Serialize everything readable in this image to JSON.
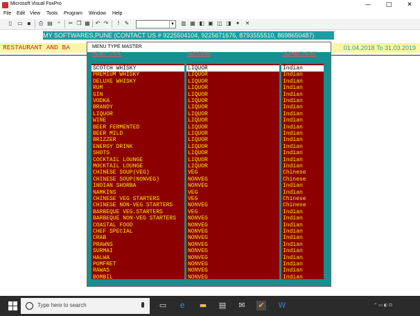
{
  "window": {
    "title": "Microsoft Visual FoxPro"
  },
  "menu": [
    "File",
    "Edit",
    "View",
    "Tools",
    "Program",
    "Window",
    "Help"
  ],
  "banner": {
    "text": "MY SOFTWARES,PUNE (CONTACT US # 9225504104, 9225671676, 8793555510, 8698650487)"
  },
  "leftband": {
    "text": "RESTAURANT AND BA"
  },
  "rightband": {
    "text": "01.04.2018 To 31.03.2019"
  },
  "dialog": {
    "title": "MENU TYPE MASTER",
    "headers": {
      "menu_type": "MENU TYPE",
      "section": "SECTION",
      "department": "DEPARTMENT"
    },
    "rows": [
      {
        "menu_type": "SCOTCH WHISKY",
        "section": "LIQUOR",
        "department": "Indian",
        "selected": true
      },
      {
        "menu_type": "PREMIUM WHISKY",
        "section": "LIQUOR",
        "department": "Indian"
      },
      {
        "menu_type": "DELUXE WHISKY",
        "section": "LIQUOR",
        "department": "Indian"
      },
      {
        "menu_type": "RUM",
        "section": "LIQUOR",
        "department": "Indian"
      },
      {
        "menu_type": "GIN",
        "section": "LIQUOR",
        "department": "Indian"
      },
      {
        "menu_type": "VODKA",
        "section": "LIQUOR",
        "department": "Indian"
      },
      {
        "menu_type": "BRANDY",
        "section": "LIQUOR",
        "department": "Indian"
      },
      {
        "menu_type": "LIQUOR",
        "section": "LIQUOR",
        "department": "Indian"
      },
      {
        "menu_type": "WINE",
        "section": "LIQUOR",
        "department": "Indian"
      },
      {
        "menu_type": "BEER FERMENTED",
        "section": "LIQUOR",
        "department": "Indian"
      },
      {
        "menu_type": "BEER MILD",
        "section": "LIQUOR",
        "department": "Indian"
      },
      {
        "menu_type": "BRIZZER",
        "section": "LIQUOR",
        "department": "Indian"
      },
      {
        "menu_type": "ENERGY DRINK",
        "section": "LIQUOR",
        "department": "Indian"
      },
      {
        "menu_type": "SHOTS",
        "section": "LIQUOR",
        "department": "Indian"
      },
      {
        "menu_type": "COCKTAIL LOUNGE",
        "section": "LIQUOR",
        "department": "Indian"
      },
      {
        "menu_type": "MOCKTAIL LOUNGE",
        "section": "LIQUOR",
        "department": "Indian"
      },
      {
        "menu_type": "CHINESE SOUP(VEG)",
        "section": "VEG",
        "department": "Chinese"
      },
      {
        "menu_type": "CHINESE SOUP(NONVEG)",
        "section": "NONVEG",
        "department": "Chinese"
      },
      {
        "menu_type": "INDIAN SHORBA",
        "section": "NONVEG",
        "department": "Indian"
      },
      {
        "menu_type": "NAMKINS",
        "section": "VEG",
        "department": "Indian"
      },
      {
        "menu_type": "CHINESE VEG STARTERS",
        "section": "VEG",
        "department": "Chinese"
      },
      {
        "menu_type": "CHINESE NON-VEG STARTERS",
        "section": "NONVEG",
        "department": "Chinese"
      },
      {
        "menu_type": "BARBEQUE VEG.STARTERS",
        "section": "VEG",
        "department": "Indian"
      },
      {
        "menu_type": "BARBEQUE NON-VEG STARTERS",
        "section": "NONVEG",
        "department": "Indian"
      },
      {
        "menu_type": "COASTAL FOOD",
        "section": "NONVEG",
        "department": "Indian"
      },
      {
        "menu_type": "CHEF SPECIAL",
        "section": "NONVEG",
        "department": "Indian"
      },
      {
        "menu_type": "CRAB",
        "section": "NONVEG",
        "department": "Indian"
      },
      {
        "menu_type": "PRAWNS",
        "section": "NONVEG",
        "department": "Indian"
      },
      {
        "menu_type": "SURMAI",
        "section": "NONVEG",
        "department": "Indian"
      },
      {
        "menu_type": "HALWA",
        "section": "NONVEG",
        "department": "Indian"
      },
      {
        "menu_type": "POMFRET",
        "section": "NONVEG",
        "department": "Indian"
      },
      {
        "menu_type": "RAWAS",
        "section": "NONVEG",
        "department": "Indian"
      },
      {
        "menu_type": "BOMBIL",
        "section": "NONVEG",
        "department": "Indian"
      }
    ]
  },
  "taskbar": {
    "search_placeholder": "Type here to search",
    "icons": [
      "windows-start-icon",
      "task-view-icon",
      "edge-icon",
      "file-explorer-icon",
      "store-icon",
      "mail-icon",
      "foxpro-icon",
      "word-icon"
    ]
  }
}
